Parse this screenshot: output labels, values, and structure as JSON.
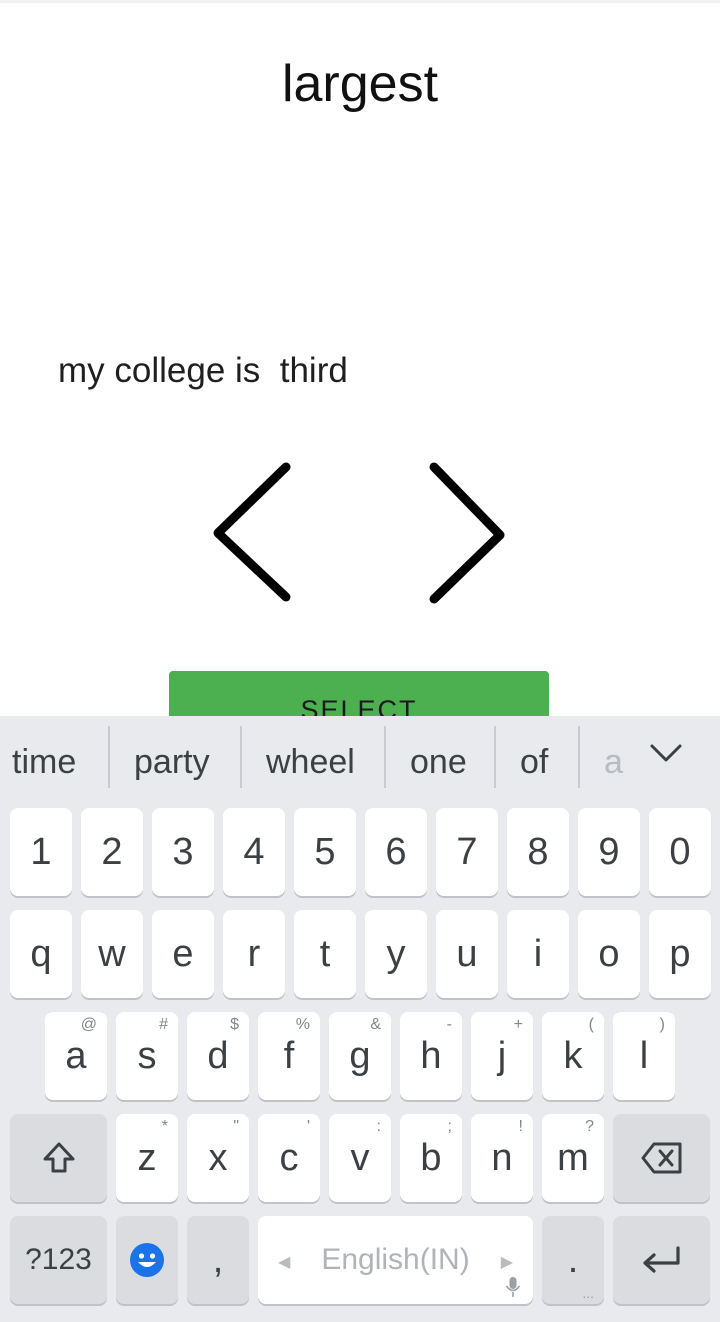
{
  "title": "largest",
  "sentence": "my college is  third",
  "select_label": "SELECT",
  "colors": {
    "button_green": "#4caf50",
    "keyboard_bg": "#e8eaed",
    "emoji_blue": "#1a73e8"
  },
  "icons": {
    "prev": "chevron-left-icon",
    "next": "chevron-right-icon",
    "collapse": "chevron-down-icon",
    "shift": "shift-icon",
    "backspace": "backspace-icon",
    "emoji": "emoji-icon",
    "enter": "enter-icon",
    "mic": "mic-icon"
  },
  "keyboard": {
    "suggestions": [
      "time",
      "party",
      "wheel",
      "one",
      "of",
      "a"
    ],
    "row_numbers": [
      "1",
      "2",
      "3",
      "4",
      "5",
      "6",
      "7",
      "8",
      "9",
      "0"
    ],
    "row_top": [
      "q",
      "w",
      "e",
      "r",
      "t",
      "y",
      "u",
      "i",
      "o",
      "p"
    ],
    "row_home": [
      {
        "key": "a",
        "hint": "@"
      },
      {
        "key": "s",
        "hint": "#"
      },
      {
        "key": "d",
        "hint": "$"
      },
      {
        "key": "f",
        "hint": "%"
      },
      {
        "key": "g",
        "hint": "&"
      },
      {
        "key": "h",
        "hint": "-"
      },
      {
        "key": "j",
        "hint": "+"
      },
      {
        "key": "k",
        "hint": "("
      },
      {
        "key": "l",
        "hint": ")"
      }
    ],
    "row_bottom": [
      {
        "key": "z",
        "hint": "*"
      },
      {
        "key": "x",
        "hint": "\""
      },
      {
        "key": "c",
        "hint": "'"
      },
      {
        "key": "v",
        "hint": ":"
      },
      {
        "key": "b",
        "hint": ";"
      },
      {
        "key": "n",
        "hint": "!"
      },
      {
        "key": "m",
        "hint": "?"
      }
    ],
    "symbols_label": "?123",
    "comma": ",",
    "space_label": "English(IN)",
    "period": ".",
    "period_dots": "..."
  }
}
